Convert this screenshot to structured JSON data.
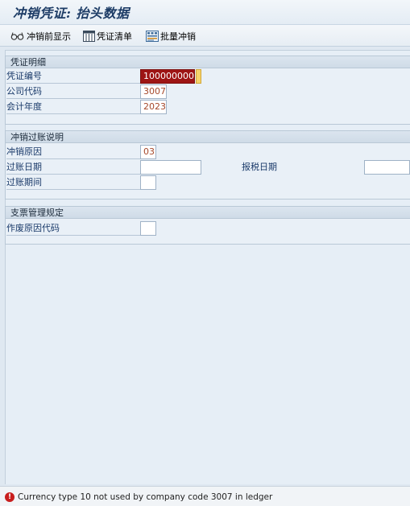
{
  "window": {
    "title": "冲销凭证: 抬头数据"
  },
  "toolbar": {
    "buttons": [
      {
        "label": "冲销前显示",
        "icon": "glasses-icon"
      },
      {
        "label": "凭证清单",
        "icon": "document-list-icon"
      },
      {
        "label": "批量冲销",
        "icon": "mass-reversal-icon"
      }
    ]
  },
  "sections": {
    "document_details": {
      "title": "凭证明细",
      "document_number": {
        "label": "凭证编号",
        "value": "100000000"
      },
      "company_code": {
        "label": "公司代码",
        "value": "3007"
      },
      "fiscal_year": {
        "label": "会计年度",
        "value": "2023"
      }
    },
    "reversal_details": {
      "title": "冲销过账说明",
      "reversal_reason": {
        "label": "冲销原因",
        "value": "03"
      },
      "posting_date": {
        "label": "过账日期",
        "value": ""
      },
      "tax_reporting_date": {
        "label": "报税日期",
        "value": ""
      },
      "posting_period": {
        "label": "过账期间",
        "value": ""
      }
    },
    "check_management": {
      "title": "支票管理规定",
      "void_reason_code": {
        "label": "作废原因代码",
        "value": ""
      }
    }
  },
  "status_bar": {
    "type": "error",
    "icon": "error-icon",
    "message": "Currency type 10 not used by company code 3007 in ledger"
  }
}
